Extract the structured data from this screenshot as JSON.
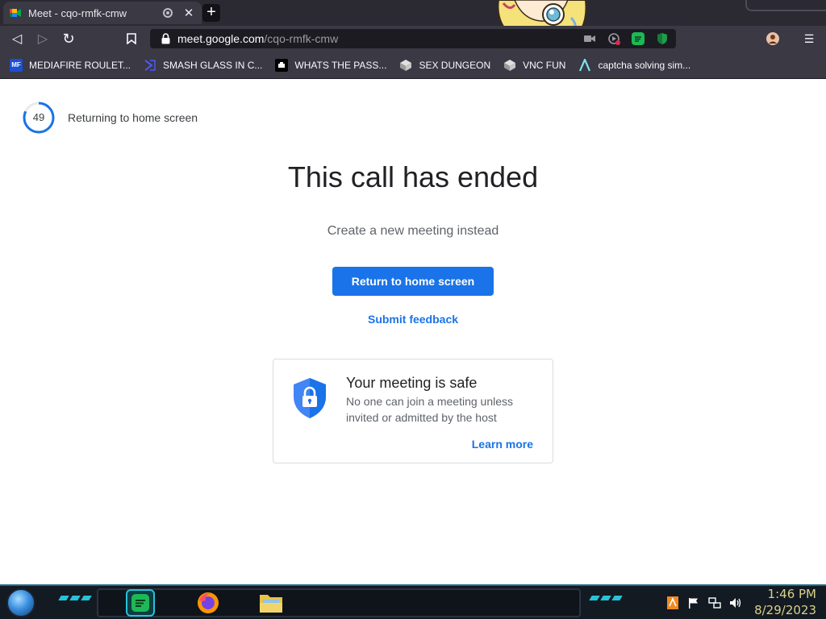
{
  "browser": {
    "tab": {
      "title": "Meet - cqo-rmfk-cmw",
      "close_glyph": "✕"
    },
    "newtab_glyph": "+",
    "url": {
      "host": "meet.google.com",
      "path": "/cqo-rmfk-cmw"
    },
    "nav": {
      "back_glyph": "◁",
      "forward_glyph": "▷",
      "reload_glyph": "↻",
      "menu_glyph": "☰"
    },
    "bookmarks": [
      {
        "label": "MEDIAFIRE ROULET...",
        "icon": "mediafire-icon"
      },
      {
        "label": "SMASH GLASS IN C...",
        "icon": "smash-icon"
      },
      {
        "label": "WHATS THE PASS...",
        "icon": "pass-icon"
      },
      {
        "label": "SEX DUNGEON",
        "icon": "vnc-icon"
      },
      {
        "label": "VNC FUN",
        "icon": "vnc-icon"
      },
      {
        "label": "captcha solving sim...",
        "icon": "captcha-icon"
      }
    ]
  },
  "meet": {
    "countdown": {
      "value": "49",
      "label": "Returning to home screen",
      "progress": 0.82
    },
    "headline": "This call has ended",
    "subline": "Create a new meeting instead",
    "primary_button": "Return to home screen",
    "feedback_link": "Submit feedback",
    "safe_card": {
      "title": "Your meeting is safe",
      "body": "No one can join a meeting unless invited or admitted by the host",
      "link": "Learn more"
    }
  },
  "taskbar": {
    "time": "1:46 PM",
    "date": "8/29/2023"
  },
  "colors": {
    "accent": "#1a73e8",
    "browser_chrome": "#3a3944",
    "taskbar_accent": "#28c2d8"
  }
}
